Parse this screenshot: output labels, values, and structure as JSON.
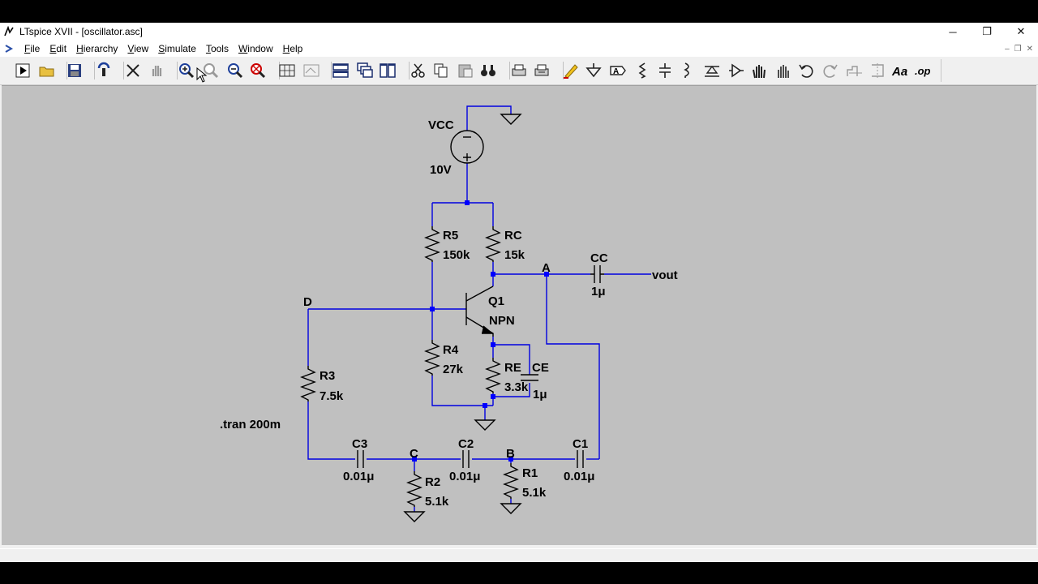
{
  "window": {
    "title": "LTspice XVII - [oscillator.asc]",
    "minimize_glyph": "─",
    "maximize_glyph": "❐",
    "close_glyph": "✕"
  },
  "menu": [
    {
      "label": "File",
      "ul": "F",
      "rest": "ile"
    },
    {
      "label": "Edit",
      "ul": "E",
      "rest": "dit"
    },
    {
      "label": "Hierarchy",
      "ul": "H",
      "rest": "ierarchy"
    },
    {
      "label": "View",
      "ul": "V",
      "rest": "iew"
    },
    {
      "label": "Simulate",
      "ul": "S",
      "rest": "imulate"
    },
    {
      "label": "Tools",
      "ul": "T",
      "rest": "ools"
    },
    {
      "label": "Window",
      "ul": "W",
      "rest": "indow"
    },
    {
      "label": "Help",
      "ul": "H",
      "rest": "elp"
    }
  ],
  "mdi_controls": [
    "–",
    "❐",
    "✕"
  ],
  "toolbar_icons": [
    "run-icon",
    "open-icon",
    "save-icon",
    "control-panel-icon",
    "halt-icon",
    "pan-hand-icon",
    "zoom-in-icon",
    "zoom-in-alt-icon",
    "zoom-out-icon",
    "zoom-fit-icon",
    "waveform-icon",
    "waveform-alt-icon",
    "tile-horizontal-icon",
    "cascade-icon",
    "tile-vertical-icon",
    "cut-icon",
    "copy-icon",
    "paste-icon",
    "find-icon",
    "print-icon",
    "print-setup-icon",
    "pencil-wire-icon",
    "ground-icon",
    "label-net-icon",
    "resistor-icon",
    "capacitor-icon",
    "inductor-icon",
    "diode-icon",
    "component-icon",
    "move-icon",
    "drag-icon",
    "undo-icon",
    "redo-icon",
    "rotate-icon",
    "mirror-icon",
    "text-icon",
    "spice-directive-icon"
  ],
  "toolbar_text": {
    "text": "Aa",
    "op": ".op"
  },
  "schematic": {
    "labels": {
      "vcc_name": "VCC",
      "vcc_value": "10V",
      "r5_name": "R5",
      "r5_value": "150k",
      "rc_name": "RC",
      "rc_value": "15k",
      "node_a": "A",
      "cc_name": "CC",
      "cc_value": "1μ",
      "vout": "vout",
      "node_d": "D",
      "q1_name": "Q1",
      "q1_type": "NPN",
      "r4_name": "R4",
      "r4_value": "27k",
      "re_name": "RE",
      "re_value": "3.3k",
      "ce_name": "CE",
      "ce_value": "1μ",
      "r3_name": "R3",
      "r3_value": "7.5k",
      "tran": ".tran 200m",
      "c3_name": "C3",
      "c3_value": "0.01μ",
      "node_c": "C",
      "c2_name": "C2",
      "c2_value": "0.01μ",
      "node_b": "B",
      "c1_name": "C1",
      "c1_value": "0.01μ",
      "r2_name": "R2",
      "r2_value": "5.1k",
      "r1_name": "R1",
      "r1_value": "5.1k"
    },
    "colors": {
      "wire": "#0000e0",
      "component": "#000000",
      "canvas": "#c0c0c0",
      "junction": "#0000ff"
    }
  }
}
